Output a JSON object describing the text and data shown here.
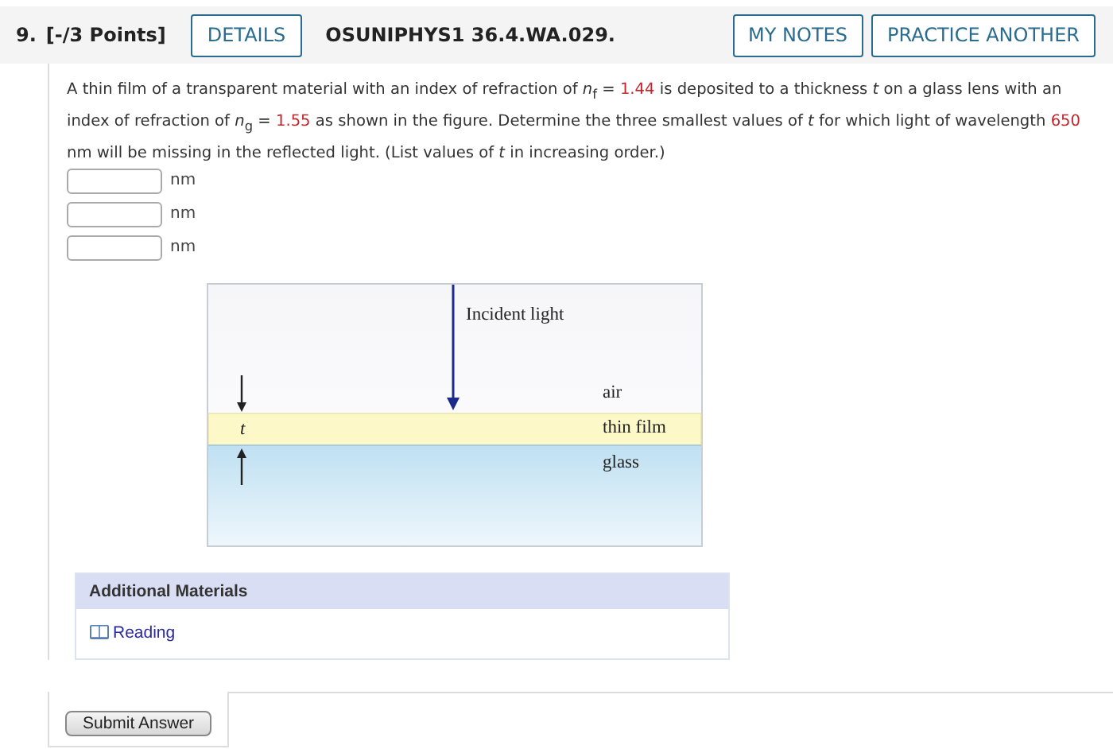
{
  "header": {
    "number": "9.",
    "points": "[-/3 Points]",
    "details_button": "DETAILS",
    "problem_id": "OSUNIPHYS1 36.4.WA.029.",
    "buttons": [
      "MY NOTES",
      "PRACTICE ANOTHER"
    ]
  },
  "question": [
    {
      "kind": "text",
      "text": "A thin film of a transparent material with an index of refraction of *n*$_{f}$ = "
    },
    {
      "kind": "value",
      "text": "1.44"
    },
    {
      "kind": "text",
      "text": " is deposited to a thickness *t* on a glass lens with an index of refraction of *n*$_{g}$ = "
    },
    {
      "kind": "value",
      "text": "1.55"
    },
    {
      "kind": "text",
      "text": " as shown in the figure. Determine the three smallest values of *t* for which light of wavelength "
    },
    {
      "kind": "value",
      "text": "650"
    },
    {
      "kind": "text",
      "text": " nm will be missing in the reflected light. (List values of *t* in increasing order.)"
    }
  ],
  "answers": [
    {
      "unit": "nm"
    },
    {
      "unit": "nm"
    },
    {
      "unit": "nm"
    }
  ],
  "figure": {
    "incident_label": "Incident light",
    "thickness_label": "t",
    "layers": [
      "air",
      "thin film",
      "glass"
    ]
  },
  "additional_materials": {
    "title": "Additional Materials",
    "links": [
      "Reading"
    ]
  },
  "submit_button": "Submit Answer"
}
